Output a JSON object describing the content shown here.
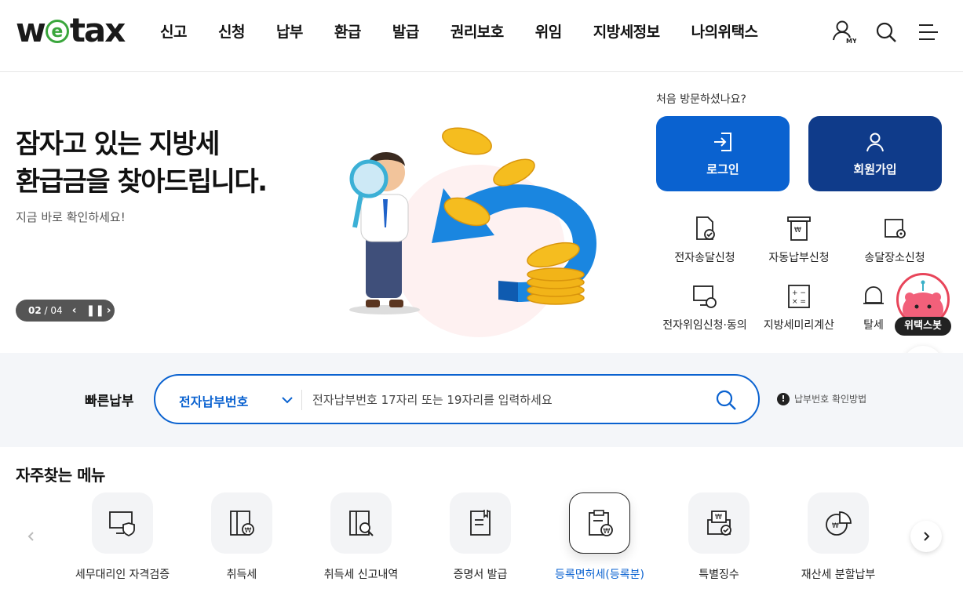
{
  "header": {
    "logo_text": "wetax",
    "nav": [
      "신고",
      "신청",
      "납부",
      "환급",
      "발급",
      "권리보호",
      "위임",
      "지방세정보",
      "나의위택스"
    ],
    "icons": [
      "my-user-icon",
      "search-icon",
      "menu-icon"
    ],
    "my_label": "MY"
  },
  "hero": {
    "title_line1": "잠자고 있는 지방세",
    "title_line2": "환급금을 찾아드립니다.",
    "subtitle": "지금 바로 확인하세요!",
    "pager_current": "02",
    "pager_total": "/ 04"
  },
  "side": {
    "first_visit": "처음 방문하셨나요?",
    "login": "로그인",
    "join": "회원가입",
    "quick": [
      {
        "label": "전자송달신청",
        "icon": "document-check-icon"
      },
      {
        "label": "자동납부신청",
        "icon": "auto-pay-icon"
      },
      {
        "label": "송달장소신청",
        "icon": "location-doc-icon"
      },
      {
        "label": "전자위임신청·동의",
        "icon": "monitor-lock-icon"
      },
      {
        "label": "지방세미리계산",
        "icon": "calculator-icon"
      },
      {
        "label": "탈세",
        "icon": "bell-icon"
      }
    ]
  },
  "chatbot": {
    "label": "위택스봇"
  },
  "quickpay": {
    "label": "빠른납부",
    "select_value": "전자납부번호",
    "placeholder": "전자납부번호 17자리 또는 19자리를 입력하세요",
    "help": "납부번호 확인방법"
  },
  "frequent": {
    "title": "자주찾는 메뉴",
    "items": [
      {
        "label": "세무대리인 자격검증",
        "icon": "monitor-shield-icon",
        "active": false
      },
      {
        "label": "취득세",
        "icon": "acquisition-tax-icon",
        "active": false
      },
      {
        "label": "취득세 신고내역",
        "icon": "acquisition-search-icon",
        "active": false
      },
      {
        "label": "증명서 발급",
        "icon": "certificate-icon",
        "active": false
      },
      {
        "label": "등록면허세(등록분)",
        "icon": "registration-tax-icon",
        "active": true
      },
      {
        "label": "특별징수",
        "icon": "special-collection-icon",
        "active": false
      },
      {
        "label": "재산세 분할납부",
        "icon": "pie-chart-icon",
        "active": false
      }
    ]
  },
  "colors": {
    "primary": "#0a62d0",
    "navy": "#0f3b8a",
    "logo_green": "#3aa63c",
    "chatbot_red": "#e8455a"
  }
}
